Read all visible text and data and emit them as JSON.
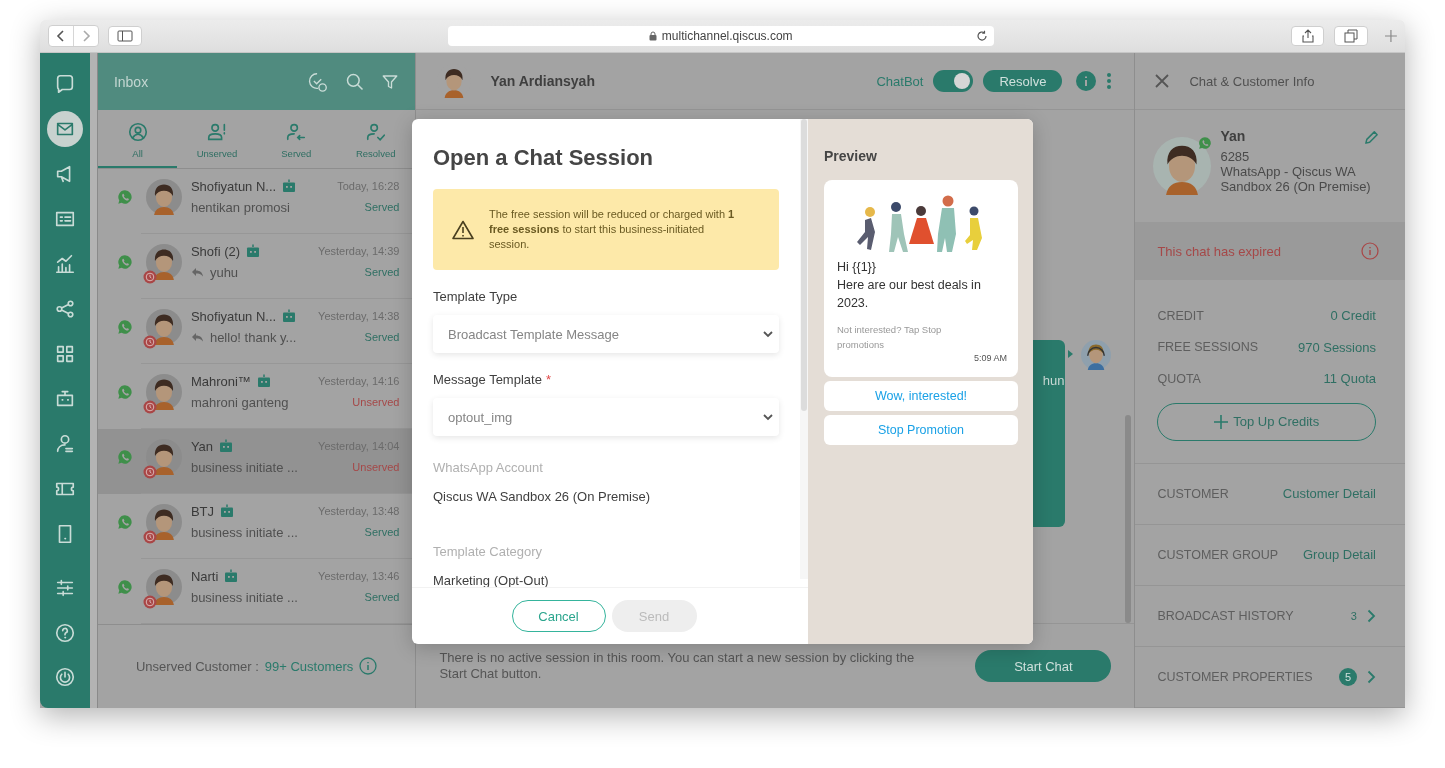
{
  "browser": {
    "address": "multichannel.qiscus.com"
  },
  "nav": [
    {
      "selected": false
    },
    {
      "selected": true
    },
    {
      "selected": false
    },
    {
      "selected": false
    },
    {
      "selected": false
    },
    {
      "selected": false
    },
    {
      "selected": false
    },
    {
      "selected": false
    },
    {
      "selected": false
    },
    {
      "selected": false
    },
    {
      "selected": false
    },
    {
      "selected": false
    },
    {
      "selected": false
    },
    {
      "selected": false
    }
  ],
  "inbox": {
    "title": "Inbox",
    "tabs": [
      {
        "label": "All",
        "selected": true
      },
      {
        "label": "Unserved",
        "selected": false
      },
      {
        "label": "Served",
        "selected": false
      },
      {
        "label": "Resolved",
        "selected": false
      }
    ],
    "conversations": [
      {
        "name": "Shofiyatun N...",
        "bot": true,
        "time": "Today, 16:28",
        "preview": "hentikan promosi",
        "reply": false,
        "expired": false,
        "status": "Served",
        "unserved": false,
        "selected": false
      },
      {
        "name": "Shofi (2)",
        "bot": true,
        "time": "Yesterday, 14:39",
        "preview": "yuhu",
        "reply": true,
        "expired": true,
        "status": "Served",
        "unserved": false,
        "selected": false
      },
      {
        "name": "Shofiyatun N...",
        "bot": true,
        "time": "Yesterday, 14:38",
        "preview": "hello! thank y...",
        "reply": true,
        "expired": true,
        "status": "Served",
        "unserved": false,
        "selected": false
      },
      {
        "name": "Mahroni™",
        "bot": true,
        "time": "Yesterday, 14:16",
        "preview": "mahroni ganteng",
        "reply": false,
        "expired": true,
        "status": "Unserved",
        "unserved": true,
        "selected": false
      },
      {
        "name": "Yan",
        "bot": true,
        "time": "Yesterday, 14:04",
        "preview": "business initiate ...",
        "reply": false,
        "expired": true,
        "status": "Unserved",
        "unserved": true,
        "selected": true
      },
      {
        "name": "BTJ",
        "bot": true,
        "time": "Yesterday, 13:48",
        "preview": "business initiate ...",
        "reply": false,
        "expired": true,
        "status": "Served",
        "unserved": false,
        "selected": false
      },
      {
        "name": "Narti",
        "bot": true,
        "time": "Yesterday, 13:46",
        "preview": "business initiate ...",
        "reply": false,
        "expired": true,
        "status": "Served",
        "unserved": false,
        "selected": false
      }
    ],
    "footer": {
      "label": "Unserved Customer :",
      "count": "99+ Customers"
    }
  },
  "chat": {
    "contact": "Yan Ardiansyah",
    "chatbot_label": "ChatBot",
    "chatbot_on": true,
    "resolve": "Resolve",
    "bubble_fragment": "hun",
    "notice": "There is no active session in this room. You can start a new session by clicking the Start Chat button.",
    "start_chat": "Start Chat"
  },
  "modal": {
    "title": "Open a Chat Session",
    "warning": "The free session will be reduced or charged with **1 free sessions** to start this business-initiated session.",
    "fields": [
      {
        "kind": "select",
        "label": "Template Type",
        "value": "Broadcast Template Message"
      },
      {
        "kind": "select",
        "label": "Message Template",
        "required_mark": "*",
        "value": "optout_img"
      },
      {
        "kind": "info",
        "label": "WhatsApp Account",
        "value": "Qiscus WA Sandbox 26 (On Premise)"
      },
      {
        "kind": "info",
        "label": "Template Category",
        "value": "Marketing (Opt-Out)"
      }
    ],
    "cancel": "Cancel",
    "send": "Send",
    "send_disabled": true,
    "preview": {
      "title": "Preview",
      "greeting": "Hi {{1}}",
      "body": "Here are our best deals in 2023.",
      "footer": "Not interested? Tap Stop promotions",
      "time": "5:09 AM",
      "buttons": [
        "Wow, interested!",
        "Stop Promotion"
      ]
    }
  },
  "info": {
    "title": "Chat & Customer Info",
    "customer": {
      "name": "Yan",
      "phone": "6285",
      "channel": "WhatsApp - Qiscus WA Sandbox 26 (On Premise)"
    },
    "expired": "This chat has expired",
    "stats": [
      {
        "label": "CREDIT",
        "value": "0 Credit"
      },
      {
        "label": "FREE SESSIONS",
        "value": "970 Sessions"
      },
      {
        "label": "QUOTA",
        "value": "11 Quota"
      }
    ],
    "top_up": "Top Up Credits",
    "sections": [
      {
        "kind": "link",
        "label": "CUSTOMER",
        "link": "Customer Detail"
      },
      {
        "kind": "link",
        "label": "CUSTOMER GROUP",
        "link": "Group Detail"
      },
      {
        "kind": "count",
        "label": "BROADCAST HISTORY",
        "count": "3"
      },
      {
        "kind": "badge",
        "label": "CUSTOMER PROPERTIES",
        "count": "5"
      }
    ]
  }
}
